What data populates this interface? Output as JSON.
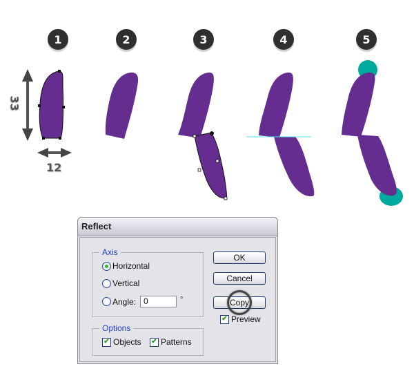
{
  "steps": [
    {
      "number": "1"
    },
    {
      "number": "2"
    },
    {
      "number": "3"
    },
    {
      "number": "4"
    },
    {
      "number": "5"
    }
  ],
  "dimensions": {
    "height": "33",
    "width": "12"
  },
  "colors": {
    "shape_fill": "#662d91",
    "accent_circle": "#00a99d",
    "reflect_axis_line": "#4de6f0",
    "badge": "#2f2f2f"
  },
  "dialog": {
    "title": "Reflect",
    "axis_group": {
      "legend": "Axis",
      "options": [
        {
          "label": "Horizontal",
          "selected": true
        },
        {
          "label": "Vertical",
          "selected": false
        },
        {
          "label": "Angle:",
          "selected": false
        }
      ],
      "angle_value": "0",
      "angle_unit": "°"
    },
    "options_group": {
      "legend": "Options",
      "objects": {
        "label": "Objects",
        "checked": true
      },
      "patterns": {
        "label": "Patterns",
        "checked": true
      }
    },
    "buttons": {
      "ok": "OK",
      "cancel": "Cancel",
      "copy": "Copy"
    },
    "preview": {
      "label": "Preview",
      "checked": true
    },
    "check_glyph": "✔"
  }
}
